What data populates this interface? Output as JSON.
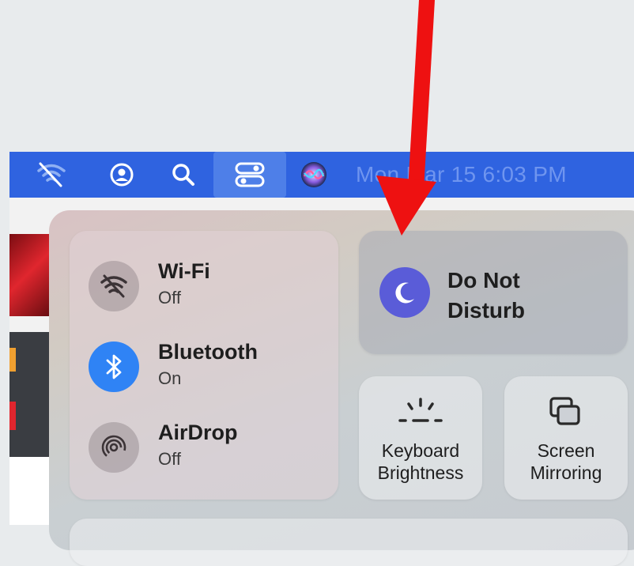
{
  "menubar": {
    "clock": "Mon Mar 15  6:03 PM",
    "accent": "#2f63e0"
  },
  "control_center": {
    "network": [
      {
        "title": "Wi-Fi",
        "status": "Off",
        "icon": "wifi-off-icon"
      },
      {
        "title": "Bluetooth",
        "status": "On",
        "icon": "bluetooth-icon"
      },
      {
        "title": "AirDrop",
        "status": "Off",
        "icon": "airdrop-icon"
      }
    ],
    "dnd": {
      "line1": "Do Not",
      "line2": "Disturb",
      "icon": "moon-icon",
      "color": "#5a5cd8"
    },
    "keyboard": {
      "line1": "Keyboard",
      "line2": "Brightness",
      "icon": "keyboard-brightness-icon"
    },
    "screen": {
      "line1": "Screen",
      "line2": "Mirroring",
      "icon": "screen-mirroring-icon"
    }
  },
  "annotation": {
    "arrow_color": "#ee1111"
  }
}
